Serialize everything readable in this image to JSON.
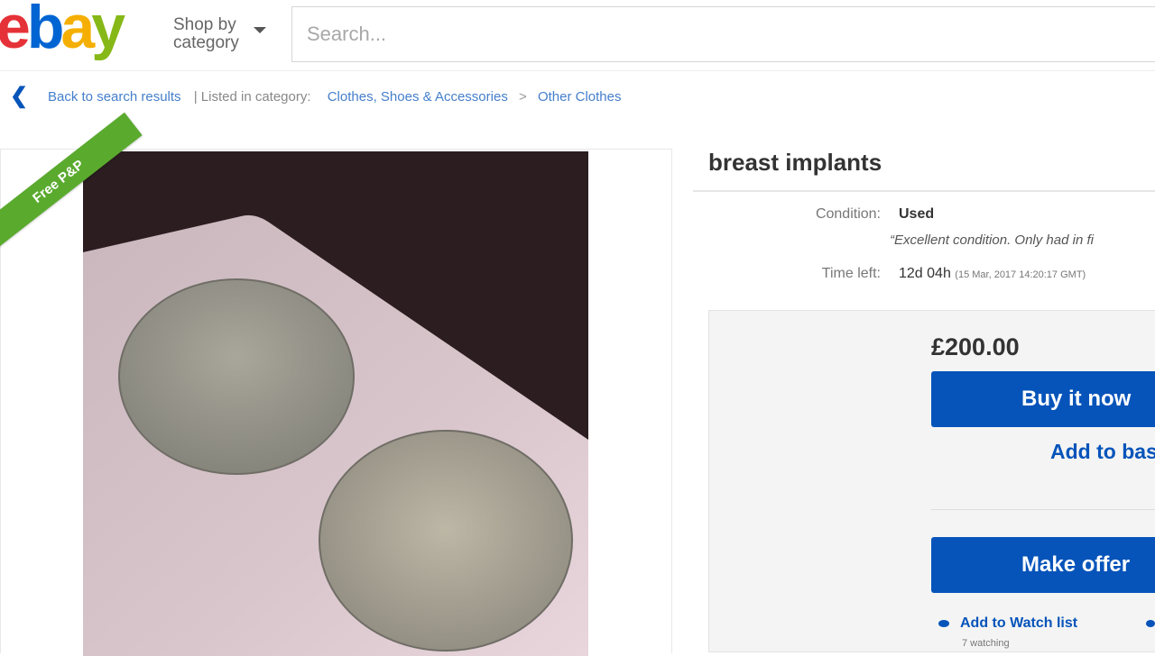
{
  "header": {
    "logo_text": "ebay",
    "shop_by_line1": "Shop by",
    "shop_by_line2": "category",
    "search_placeholder": "Search..."
  },
  "breadcrumb": {
    "back_label": "Back to search results",
    "listed_in": "| Listed in category:",
    "category": "Clothes, Shoes & Accessories",
    "subcategory": "Other Clothes",
    "separator": ">"
  },
  "listing": {
    "ribbon": "Free P&P",
    "title": "breast implants",
    "condition_label": "Condition:",
    "condition_value": "Used",
    "condition_note": "“Excellent condition. Only had in fi",
    "time_label": "Time left:",
    "time_value": "12d 04h",
    "time_detail": "(15 Mar, 2017 14:20:17 GMT)",
    "price": "£200.00",
    "buy_now": "Buy it now",
    "add_basket": "Add to basket",
    "make_offer": "Make offer",
    "watch": "Add to Watch list",
    "watchers": "7 watching"
  },
  "colors": {
    "ebay_red": "#e53238",
    "ebay_blue": "#0064d2",
    "ebay_yellow": "#f5af02",
    "ebay_green": "#86b817",
    "button_blue": "#0654ba",
    "ribbon_green": "#5aaa2e"
  }
}
